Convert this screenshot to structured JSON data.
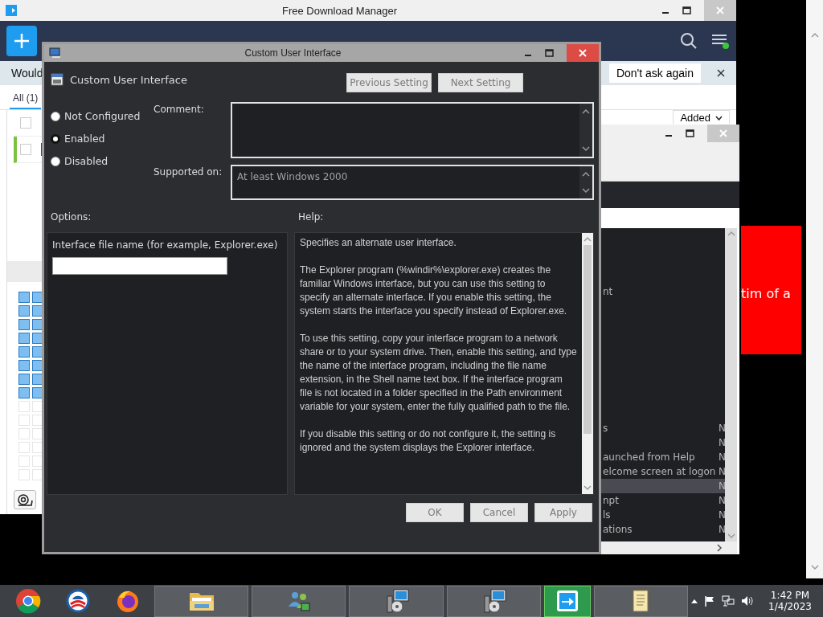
{
  "fdm_window": {
    "title": "Free Download Manager",
    "notification": {
      "text": "Would",
      "button": "Don't ask again"
    },
    "tabs": [
      {
        "label": "All (1)",
        "selected": true
      }
    ],
    "sort_column": "Added",
    "rows": [
      {
        "checked": false
      },
      {
        "checked": false
      }
    ]
  },
  "background_window": {
    "partial_text": "nt",
    "rows": [
      {
        "name": "s",
        "state": "N",
        "selected": false
      },
      {
        "state": "N",
        "selected": false
      },
      {
        "name": "aunched from Help",
        "state": "N",
        "selected": false
      },
      {
        "name": "elcome screen at logon",
        "state": "N",
        "selected": false
      },
      {
        "state": "N",
        "selected": true
      },
      {
        "name": "npt",
        "state": "N",
        "selected": false
      },
      {
        "name": "ls",
        "state": "N",
        "selected": false
      },
      {
        "name": "ations",
        "state": "N",
        "selected": false
      }
    ]
  },
  "banner": {
    "text": "tim of a"
  },
  "dialog": {
    "title": "Custom User Interface",
    "setting_name": "Custom User Interface",
    "nav_buttons": [
      {
        "label": "Previous Setting",
        "disabled": true
      },
      {
        "label": "Next Setting",
        "disabled": true
      }
    ],
    "radios": [
      {
        "label": "Not Configured",
        "selected": false
      },
      {
        "label": "Enabled",
        "selected": true
      },
      {
        "label": "Disabled",
        "selected": false
      }
    ],
    "comment_label": "Comment:",
    "supported_label": "Supported on:",
    "supported_value": "At least Windows 2000",
    "options_label": "Options:",
    "help_label": "Help:",
    "option_field_label": "Interface file name (for example, Explorer.exe)",
    "help": [
      "Specifies an alternate user interface.",
      "The Explorer program (%windir%\\explorer.exe) creates the familiar Windows interface, but you can use this setting to specify an alternate interface. If you enable this setting, the system starts the interface you specify instead of Explorer.exe.",
      "To use this setting, copy your interface program to a network share or to your system drive. Then, enable this setting, and type the name of the interface program, including the file name extension, in the Shell name text box. If the interface program file is not located in a folder specified in the Path environment variable for your system, enter the fully qualified path to the file.",
      "If you disable this setting or do not configure it, the setting is ignored and the system displays the Explorer interface."
    ],
    "footer_buttons": [
      {
        "label": "OK",
        "disabled": true
      },
      {
        "label": "Cancel",
        "disabled": true
      },
      {
        "label": "Apply",
        "disabled": true
      }
    ]
  },
  "taskbar": {
    "apps": [
      {
        "kind": "chrome",
        "selected": false
      },
      {
        "kind": "globe",
        "selected": false
      },
      {
        "kind": "firefox",
        "selected": false
      },
      {
        "kind": "folder",
        "selected": false
      },
      {
        "kind": "people",
        "selected": false
      },
      {
        "kind": "installer",
        "selected": false
      },
      {
        "kind": "installer",
        "selected": false
      },
      {
        "kind": "fdm",
        "selected": true
      },
      {
        "kind": "scroll",
        "selected": false
      }
    ],
    "clock": {
      "time": "1:42 PM",
      "date": "1/4/2023"
    }
  }
}
